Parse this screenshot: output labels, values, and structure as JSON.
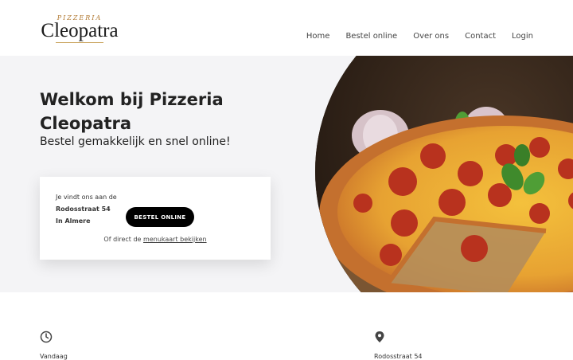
{
  "header": {
    "logo_small": "PIZZERIA",
    "logo_big": "Cleopatra",
    "nav": [
      "Home",
      "Bestel online",
      "Over ons",
      "Contact",
      "Login"
    ]
  },
  "hero": {
    "title": "Welkom bij Pizzeria Cleopatra",
    "subtitle": "Bestel gemakkelijk en snel online!",
    "card": {
      "intro": "Je vindt ons aan de",
      "street": "Rodosstraat 54",
      "city": "In Almere",
      "button": "BESTEL ONLINE",
      "link_prefix": "Of direct de",
      "link": "menukaart bekijken"
    }
  },
  "info": {
    "left_label": "Vandaag",
    "right_label": "Rodosstraat 54",
    "left_icon": "clock-icon",
    "right_icon": "map-pin-icon"
  }
}
